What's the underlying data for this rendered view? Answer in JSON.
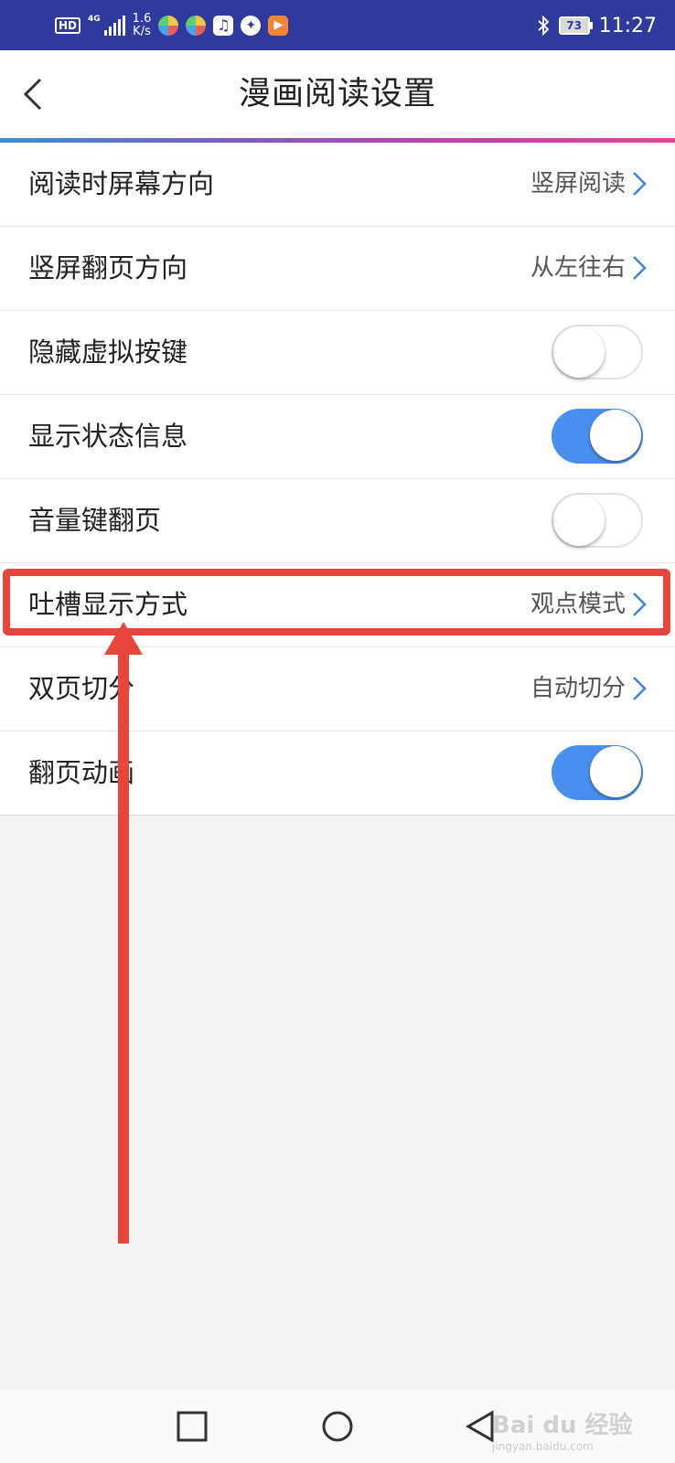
{
  "status_bar": {
    "hd": "HD",
    "network": "4G",
    "speed_value": "1.6",
    "speed_unit": "K/s",
    "battery": "73",
    "time": "11:27",
    "icons": [
      "app-icon-1",
      "app-icon-2",
      "music-icon",
      "browser-icon",
      "video-icon",
      "bluetooth-icon"
    ]
  },
  "header": {
    "title": "漫画阅读设置",
    "back_icon": "chevron-left-icon",
    "accent_gradient": [
      "#3d8ed8",
      "#7b5cc7",
      "#c040a8",
      "#e0459a"
    ]
  },
  "settings": [
    {
      "label": "阅读时屏幕方向",
      "value": "竖屏阅读",
      "type": "link"
    },
    {
      "label": "竖屏翻页方向",
      "value": "从左往右",
      "type": "link"
    },
    {
      "label": "隐藏虚拟按键",
      "type": "toggle",
      "on": false
    },
    {
      "label": "显示状态信息",
      "type": "toggle",
      "on": true
    },
    {
      "label": "音量键翻页",
      "type": "toggle",
      "on": false
    },
    {
      "label": "吐槽显示方式",
      "value": "观点模式",
      "type": "link",
      "highlighted": true
    },
    {
      "label": "双页切分",
      "value": "自动切分",
      "type": "link"
    },
    {
      "label": "翻页动画",
      "type": "toggle",
      "on": true
    }
  ],
  "colors": {
    "toggle_on": "#4a8ef0",
    "chevron": "#3a86e0",
    "annotation": "#e8453c",
    "status_bar": "#2f3a9c"
  },
  "nav_bar": {
    "recents_icon": "square-icon",
    "home_icon": "circle-icon",
    "back_icon": "triangle-back-icon"
  },
  "watermark": {
    "brand": "Bai du 经验",
    "url": "jingyan.baidu.com"
  }
}
